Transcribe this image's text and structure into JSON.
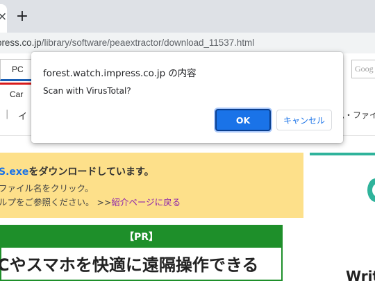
{
  "browser": {
    "tab_close_icon": "close-icon",
    "new_tab_icon": "plus-icon",
    "url": {
      "host": "press.co.jp",
      "path": "/library/software/peaextractor/download_11537.html"
    }
  },
  "site_header": {
    "tabs": [
      {
        "label": "PC",
        "accent": "#1a5fb4"
      },
      {
        "label": "Car",
        "accent": "#d81b1b"
      }
    ],
    "search_placeholder": "Goog",
    "nav_separator": "|",
    "nav_left": "イ",
    "nav_right": "ム・ファイ"
  },
  "notice": {
    "line1_file": "S.exe",
    "line1_rest": "をダウンロードしています。",
    "line2": "ファイル名をクリック。",
    "line3_text": "ルプをご参照ください。 >>",
    "line3_link": "紹介ページに戻る",
    "background": "#fde08a"
  },
  "pr": {
    "label": "【PR】",
    "title": "Cやスマホを快適に遠隔操作できる",
    "accent": "#1e8f2a"
  },
  "right_column": {
    "heading": "Writ",
    "accent": "#2fb39b"
  },
  "dialog": {
    "title": "forest.watch.impress.co.jp の内容",
    "message": "Scan with VirusTotal?",
    "ok_label": "OK",
    "cancel_label": "キャンセル",
    "primary_color": "#1a73e8"
  }
}
